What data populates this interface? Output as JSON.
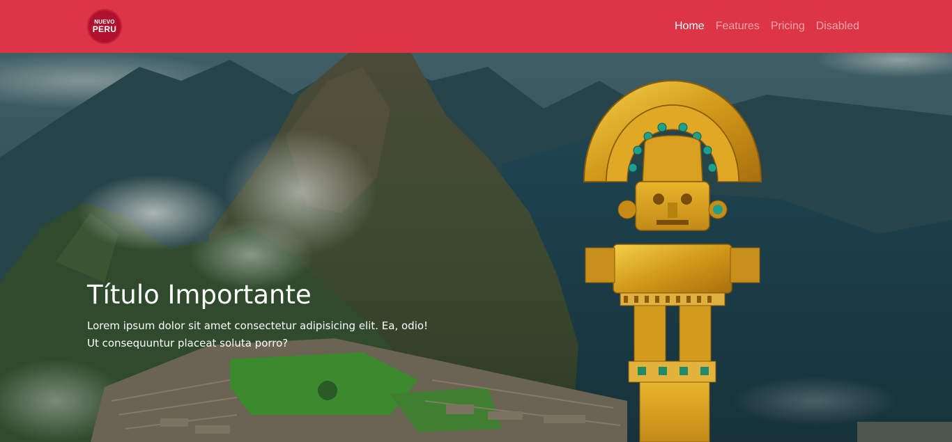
{
  "brand": {
    "logo_line1": "NUEVO",
    "logo_line2": "PERU"
  },
  "nav": {
    "items": [
      {
        "label": "Home",
        "state": "active"
      },
      {
        "label": "Features",
        "state": "normal"
      },
      {
        "label": "Pricing",
        "state": "normal"
      },
      {
        "label": "Disabled",
        "state": "disabled"
      }
    ]
  },
  "hero": {
    "title": "Título Importante",
    "text": "Lorem ipsum dolor sit amet consectetur adipisicing elit. Ea, odio! Ut consequuntur placeat soluta porro?"
  },
  "colors": {
    "navbar": "#dc3545",
    "logo": "#b0112e",
    "gold": "#d9a520"
  }
}
